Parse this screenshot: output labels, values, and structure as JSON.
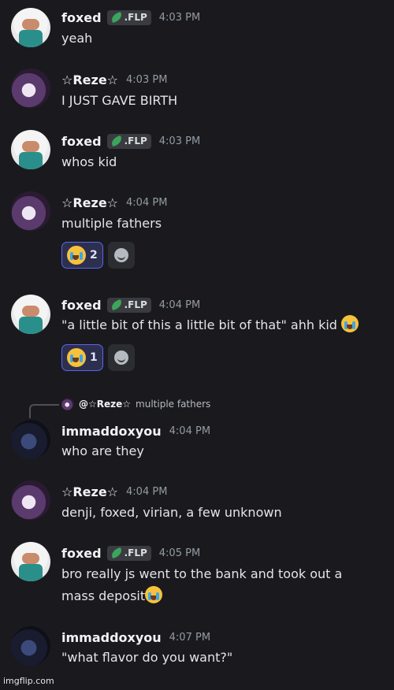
{
  "messages": [
    {
      "user": "foxed",
      "tag": ".FLP",
      "time": "4:03 PM",
      "lines": [
        "yeah"
      ]
    },
    {
      "user": "☆Reze☆",
      "time": "4:03 PM",
      "lines": [
        "I JUST GAVE BIRTH"
      ]
    },
    {
      "user": "foxed",
      "tag": ".FLP",
      "time": "4:03 PM",
      "lines": [
        "whos kid"
      ]
    },
    {
      "user": "☆Reze☆",
      "time": "4:04 PM",
      "lines": [
        "multiple fathers"
      ],
      "reaction_count": "2"
    },
    {
      "user": "foxed",
      "tag": ".FLP",
      "time": "4:04 PM",
      "lines": [
        "\"a little bit of this a little bit of that\" ahh kid"
      ],
      "reaction_count": "1"
    },
    {
      "user": "immaddoxyou",
      "time": "4:04 PM",
      "lines": [
        "who are they"
      ],
      "reply": {
        "name": "@☆Reze☆",
        "text": "multiple fathers"
      }
    },
    {
      "user": "☆Reze☆",
      "time": "4:04 PM",
      "lines": [
        "denji, foxed, virian, a few unknown"
      ]
    },
    {
      "user": "foxed",
      "tag": ".FLP",
      "time": "4:05 PM",
      "lines": [
        "bro really js went to the bank and took out a",
        "mass deposit"
      ]
    },
    {
      "user": "immaddoxyou",
      "time": "4:07 PM",
      "lines": [
        "\"what flavor do you want?\""
      ]
    }
  ],
  "icons": {
    "reaction_emoji": "loudly-crying-face-icon",
    "add_reaction": "add-reaction-icon",
    "tag_icon": "leaf-icon"
  },
  "colors": {
    "background": "#1a1a1e",
    "reaction_border": "#5865f2",
    "tag_leaf": "#3ba55c"
  },
  "watermark": "imgflip.com"
}
